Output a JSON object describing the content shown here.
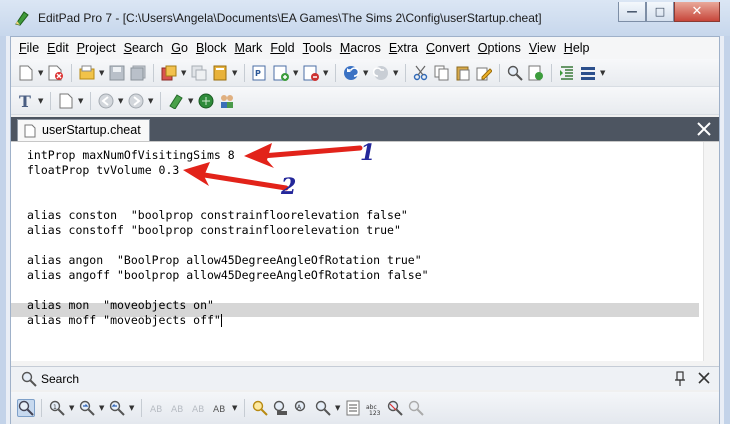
{
  "window": {
    "title": "EditPad Pro 7 - [C:\\Users\\Angela\\Documents\\EA Games\\The Sims 2\\Config\\userStartup.cheat]",
    "minimize_glyph": "—",
    "maximize_glyph": "□",
    "close_glyph": "✕"
  },
  "menu": [
    {
      "label": "File",
      "key": "F",
      "rest": "ile"
    },
    {
      "label": "Edit",
      "key": "E",
      "rest": "dit"
    },
    {
      "label": "Project",
      "key": "P",
      "rest": "roject"
    },
    {
      "label": "Search",
      "key": "S",
      "rest": "earch"
    },
    {
      "label": "Go",
      "key": "G",
      "rest": "o"
    },
    {
      "label": "Block",
      "key": "B",
      "rest": "lock"
    },
    {
      "label": "Mark",
      "key": "M",
      "rest": "ark"
    },
    {
      "label": "Fold",
      "key": "Fo",
      "rest": "ld"
    },
    {
      "label": "Tools",
      "key": "T",
      "rest": "ools"
    },
    {
      "label": "Macros",
      "key": "M",
      "rest": "acros"
    },
    {
      "label": "Extra",
      "key": "E",
      "rest": "xtra"
    },
    {
      "label": "Convert",
      "key": "C",
      "rest": "onvert"
    },
    {
      "label": "Options",
      "key": "O",
      "rest": "ptions"
    },
    {
      "label": "View",
      "key": "V",
      "rest": "iew"
    },
    {
      "label": "Help",
      "key": "H",
      "rest": "elp"
    }
  ],
  "tab": {
    "label": "userStartup.cheat"
  },
  "editor": {
    "lines": [
      "intProp maxNumOfVisitingSims 8",
      "floatProp tvVolume 0.3",
      "",
      "",
      "alias conston  \"boolprop constrainfloorelevation false\"",
      "alias constoff \"boolprop constrainfloorelevation true\"",
      "",
      "alias angon  \"BoolProp allow45DegreeAngleOfRotation true\"",
      "alias angoff \"boolprop allow45DegreeAngleOfRotation false\"",
      "",
      "alias mon  \"moveobjects on\"",
      "alias moff \"moveobjects off\""
    ],
    "current_line": 12
  },
  "search": {
    "label": "Search"
  },
  "annotations": {
    "one": "1",
    "two": "2",
    "arrow_color": "#e2231a",
    "number_color": "#24279a"
  },
  "colors": {
    "tabbar": "#4d5561",
    "current_line": "#d6d6d6",
    "title_bar": "#c7d7ec"
  }
}
